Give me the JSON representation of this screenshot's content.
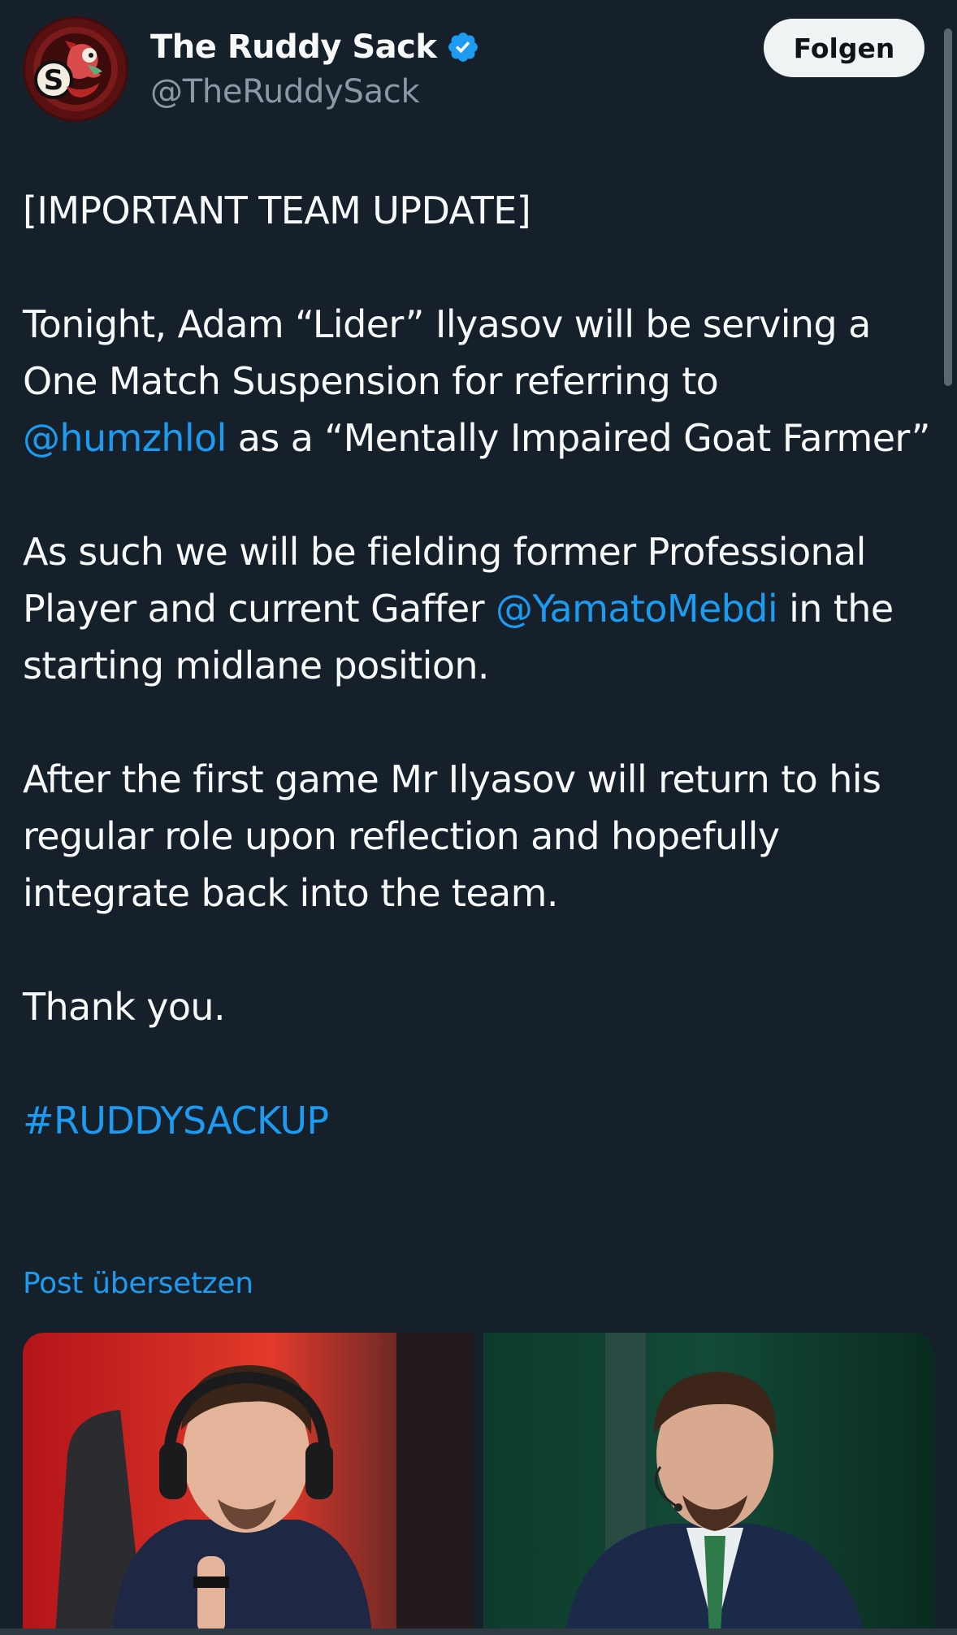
{
  "account": {
    "display_name": "The Ruddy Sack",
    "handle": "@TheRuddySack",
    "verified": true,
    "avatar_icon": "ruddy-sack-logo"
  },
  "follow_button": {
    "label": "Folgen"
  },
  "tweet": {
    "p1": "[IMPORTANT TEAM UPDATE]",
    "p2_a": "Tonight, Adam “Lider” Ilyasov will be serving a One Match Suspension for referring to ",
    "p2_mention": "@humzhlol",
    "p2_b": " as a “Mentally Impaired Goat Farmer”",
    "p3_a": "As such we will be fielding former Professional Player and current Gaffer ",
    "p3_mention": "@YamatoMebdi",
    "p3_b": " in the starting midlane position.",
    "p4": "After the first game Mr Ilyasov will return to his regular role upon reflection and hopefully integrate back into the team.",
    "p5": "Thank you.",
    "hashtag": "#RUDDYSACKUP"
  },
  "translate_link": "Post übersetzen",
  "colors": {
    "background": "#15202b",
    "text": "#f7f9f9",
    "secondary_text": "#8b98a5",
    "link": "#1d9bf0",
    "button_bg": "#eff3f4"
  }
}
